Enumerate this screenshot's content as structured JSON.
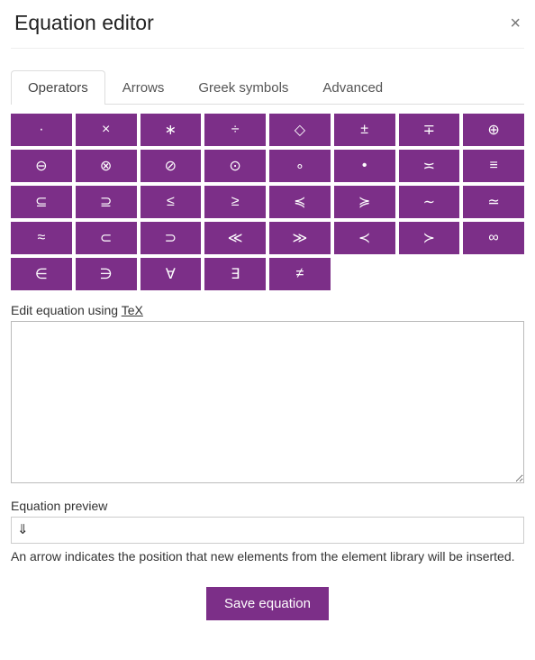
{
  "dialog": {
    "title": "Equation editor",
    "close_glyph": "×"
  },
  "tabs": [
    {
      "id": "operators",
      "label": "Operators",
      "active": true
    },
    {
      "id": "arrows",
      "label": "Arrows",
      "active": false
    },
    {
      "id": "greek",
      "label": "Greek symbols",
      "active": false
    },
    {
      "id": "advanced",
      "label": "Advanced",
      "active": false
    }
  ],
  "symbols": [
    "·",
    "×",
    "∗",
    "÷",
    "◇",
    "±",
    "∓",
    "⊕",
    "⊖",
    "⊗",
    "⊘",
    "⊙",
    "∘",
    "•",
    "≍",
    "≡",
    "⊆",
    "⊇",
    "≤",
    "≥",
    "≼",
    "≽",
    "∼",
    "≃",
    "≈",
    "⊂",
    "⊃",
    "≪",
    "≫",
    "≺",
    "≻",
    "∞",
    "∈",
    "∋",
    "∀",
    "∃",
    "≠"
  ],
  "editor": {
    "label_prefix": "Edit equation using ",
    "tex_label": "TeX",
    "value": ""
  },
  "preview": {
    "label": "Equation preview",
    "content": "⇓",
    "hint": "An arrow indicates the position that new elements from the element library will be inserted."
  },
  "actions": {
    "save_label": "Save equation"
  }
}
